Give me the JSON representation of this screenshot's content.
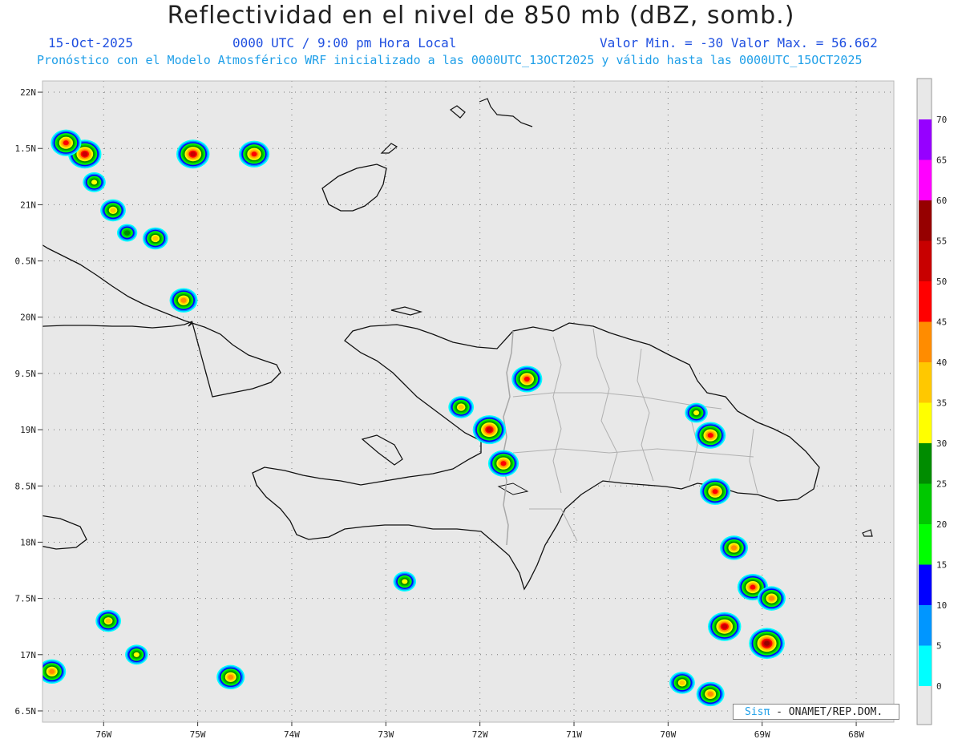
{
  "header": {
    "title": "Reflectividad en el nivel de 850 mb (dBZ, somb.)",
    "date": "15-Oct-2025",
    "time": "0000 UTC / 9:00 pm Hora Local",
    "minmax": "Valor Min. = -30  Valor Max. = 56.662",
    "model_line": "Pronóstico con el Modelo Atmosférico WRF inicializado a las 0000UTC_13OCT2025 y válido hasta las  0000UTC_15OCT2025"
  },
  "map": {
    "lon_range": [
      -76.65,
      -67.6
    ],
    "lat_range": [
      16.4,
      22.1
    ],
    "lat_ticks": [
      {
        "value": 22.0,
        "label": "22N"
      },
      {
        "value": 21.5,
        "label": "1.5N"
      },
      {
        "value": 21.0,
        "label": "21N"
      },
      {
        "value": 20.5,
        "label": "0.5N"
      },
      {
        "value": 20.0,
        "label": "20N"
      },
      {
        "value": 19.5,
        "label": "9.5N"
      },
      {
        "value": 19.0,
        "label": "19N"
      },
      {
        "value": 18.5,
        "label": "8.5N"
      },
      {
        "value": 18.0,
        "label": "18N"
      },
      {
        "value": 17.5,
        "label": "7.5N"
      },
      {
        "value": 17.0,
        "label": "17N"
      },
      {
        "value": 16.5,
        "label": "6.5N"
      }
    ],
    "lon_ticks": [
      {
        "value": -76,
        "label": "76W"
      },
      {
        "value": -75,
        "label": "75W"
      },
      {
        "value": -74,
        "label": "74W"
      },
      {
        "value": -73,
        "label": "73W"
      },
      {
        "value": -72,
        "label": "72W"
      },
      {
        "value": -71,
        "label": "71W"
      },
      {
        "value": -70,
        "label": "70W"
      },
      {
        "value": -69,
        "label": "69W"
      },
      {
        "value": -68,
        "label": "68W"
      }
    ],
    "colors": {
      "land_bg": "#e8e8e8",
      "coast": "#111111",
      "border": "#a8a8a8",
      "grid": "#777777"
    }
  },
  "colorbar": {
    "levels": [
      "0",
      "5",
      "10",
      "15",
      "20",
      "25",
      "30",
      "35",
      "40",
      "45",
      "50",
      "55",
      "60",
      "65",
      "70"
    ],
    "colors": [
      "#00ffff",
      "#0096ff",
      "#0000ff",
      "#00ff00",
      "#00c800",
      "#008c00",
      "#ffff00",
      "#ffc800",
      "#ff8c00",
      "#ff0000",
      "#c80000",
      "#960000",
      "#ff00ff",
      "#9600ff"
    ]
  },
  "storms": [
    {
      "lon": -76.2,
      "lat": 21.45,
      "dbz": 50
    },
    {
      "lon": -76.4,
      "lat": 21.55,
      "dbz": 45
    },
    {
      "lon": -76.1,
      "lat": 21.2,
      "dbz": 30
    },
    {
      "lon": -75.05,
      "lat": 21.45,
      "dbz": 50
    },
    {
      "lon": -74.4,
      "lat": 21.45,
      "dbz": 45
    },
    {
      "lon": -75.9,
      "lat": 20.95,
      "dbz": 35
    },
    {
      "lon": -75.75,
      "lat": 20.75,
      "dbz": 25
    },
    {
      "lon": -75.45,
      "lat": 20.7,
      "dbz": 35
    },
    {
      "lon": -75.15,
      "lat": 20.15,
      "dbz": 40
    },
    {
      "lon": -71.5,
      "lat": 19.45,
      "dbz": 45
    },
    {
      "lon": -71.9,
      "lat": 19.0,
      "dbz": 50
    },
    {
      "lon": -72.2,
      "lat": 19.2,
      "dbz": 35
    },
    {
      "lon": -71.75,
      "lat": 18.7,
      "dbz": 45
    },
    {
      "lon": -69.55,
      "lat": 18.95,
      "dbz": 45
    },
    {
      "lon": -69.7,
      "lat": 19.15,
      "dbz": 30
    },
    {
      "lon": -69.4,
      "lat": 17.25,
      "dbz": 50
    },
    {
      "lon": -68.95,
      "lat": 17.1,
      "dbz": 55
    },
    {
      "lon": -69.1,
      "lat": 17.6,
      "dbz": 45
    },
    {
      "lon": -68.9,
      "lat": 17.5,
      "dbz": 40
    },
    {
      "lon": -69.3,
      "lat": 17.95,
      "dbz": 40
    },
    {
      "lon": -69.55,
      "lat": 16.65,
      "dbz": 40
    },
    {
      "lon": -69.85,
      "lat": 16.75,
      "dbz": 35
    },
    {
      "lon": -69.5,
      "lat": 18.45,
      "dbz": 45
    },
    {
      "lon": -76.55,
      "lat": 16.85,
      "dbz": 40
    },
    {
      "lon": -74.65,
      "lat": 16.8,
      "dbz": 40
    },
    {
      "lon": -75.95,
      "lat": 17.3,
      "dbz": 35
    },
    {
      "lon": -75.65,
      "lat": 17.0,
      "dbz": 30
    },
    {
      "lon": -72.8,
      "lat": 17.65,
      "dbz": 30
    }
  ],
  "credit": {
    "sis": "Sis",
    "pi": "π",
    "text": "- ONAMET/REP.DOM."
  }
}
